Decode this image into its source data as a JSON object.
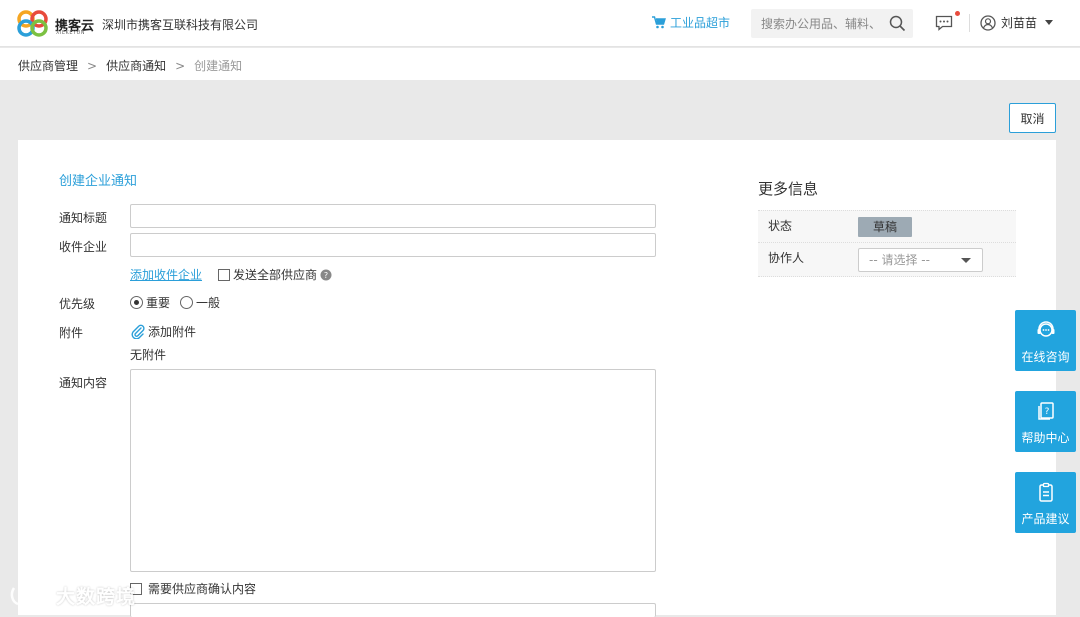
{
  "header": {
    "logo_text": "携客云",
    "logo_sub": "XIEKEYUN",
    "company": "深圳市携客互联科技有限公司",
    "mall_link": "工业品超市",
    "search_placeholder": "搜索办公用品、辅料、",
    "user_name": "刘苗苗"
  },
  "breadcrumb": {
    "items": [
      "供应商管理",
      "供应商通知",
      "创建通知"
    ],
    "separator": ">"
  },
  "toolbar": {
    "cancel_label": "取消"
  },
  "form": {
    "section_title": "创建企业通知",
    "title_label": "通知标题",
    "title_value": "",
    "company_label": "收件企业",
    "company_value": "",
    "add_company_link": "添加收件企业",
    "send_all_label": "发送全部供应商",
    "priority_label": "优先级",
    "priority_options": [
      "重要",
      "一般"
    ],
    "priority_selected": "重要",
    "attachment_label": "附件",
    "add_attachment": "添加附件",
    "no_attachment": "无附件",
    "content_label": "通知内容",
    "content_value": "",
    "confirm_label": "需要供应商确认内容"
  },
  "more_info": {
    "title": "更多信息",
    "status_label": "状态",
    "status_value": "草稿",
    "collaborator_label": "协作人",
    "collaborator_placeholder": "-- 请选择 --"
  },
  "float_buttons": [
    {
      "label": "在线咨询",
      "icon": "headset-icon"
    },
    {
      "label": "帮助中心",
      "icon": "help-doc-icon"
    },
    {
      "label": "产品建议",
      "icon": "clipboard-icon"
    }
  ],
  "watermark": "大数跨境",
  "colors": {
    "accent": "#2b9fd9",
    "float_bg": "#22a4de",
    "badge_bg": "#9daab4",
    "notification_dot": "#e84b3c"
  }
}
